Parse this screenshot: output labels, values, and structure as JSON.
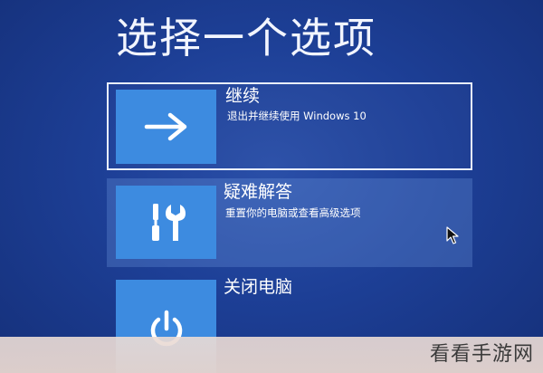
{
  "header": {
    "title": "选择一个选项"
  },
  "options": [
    {
      "title": "继续",
      "description": "退出并继续使用 Windows 10",
      "icon": "arrow-right-icon"
    },
    {
      "title": "疑难解答",
      "description": "重置你的电脑或查看高级选项",
      "icon": "tools-icon"
    },
    {
      "title": "关闭电脑",
      "description": "",
      "icon": "power-icon"
    }
  ],
  "watermark": {
    "text": "看看手游网"
  },
  "colors": {
    "background": "#1d3f96",
    "tile": "#3d8be0",
    "text": "#ffffff"
  }
}
